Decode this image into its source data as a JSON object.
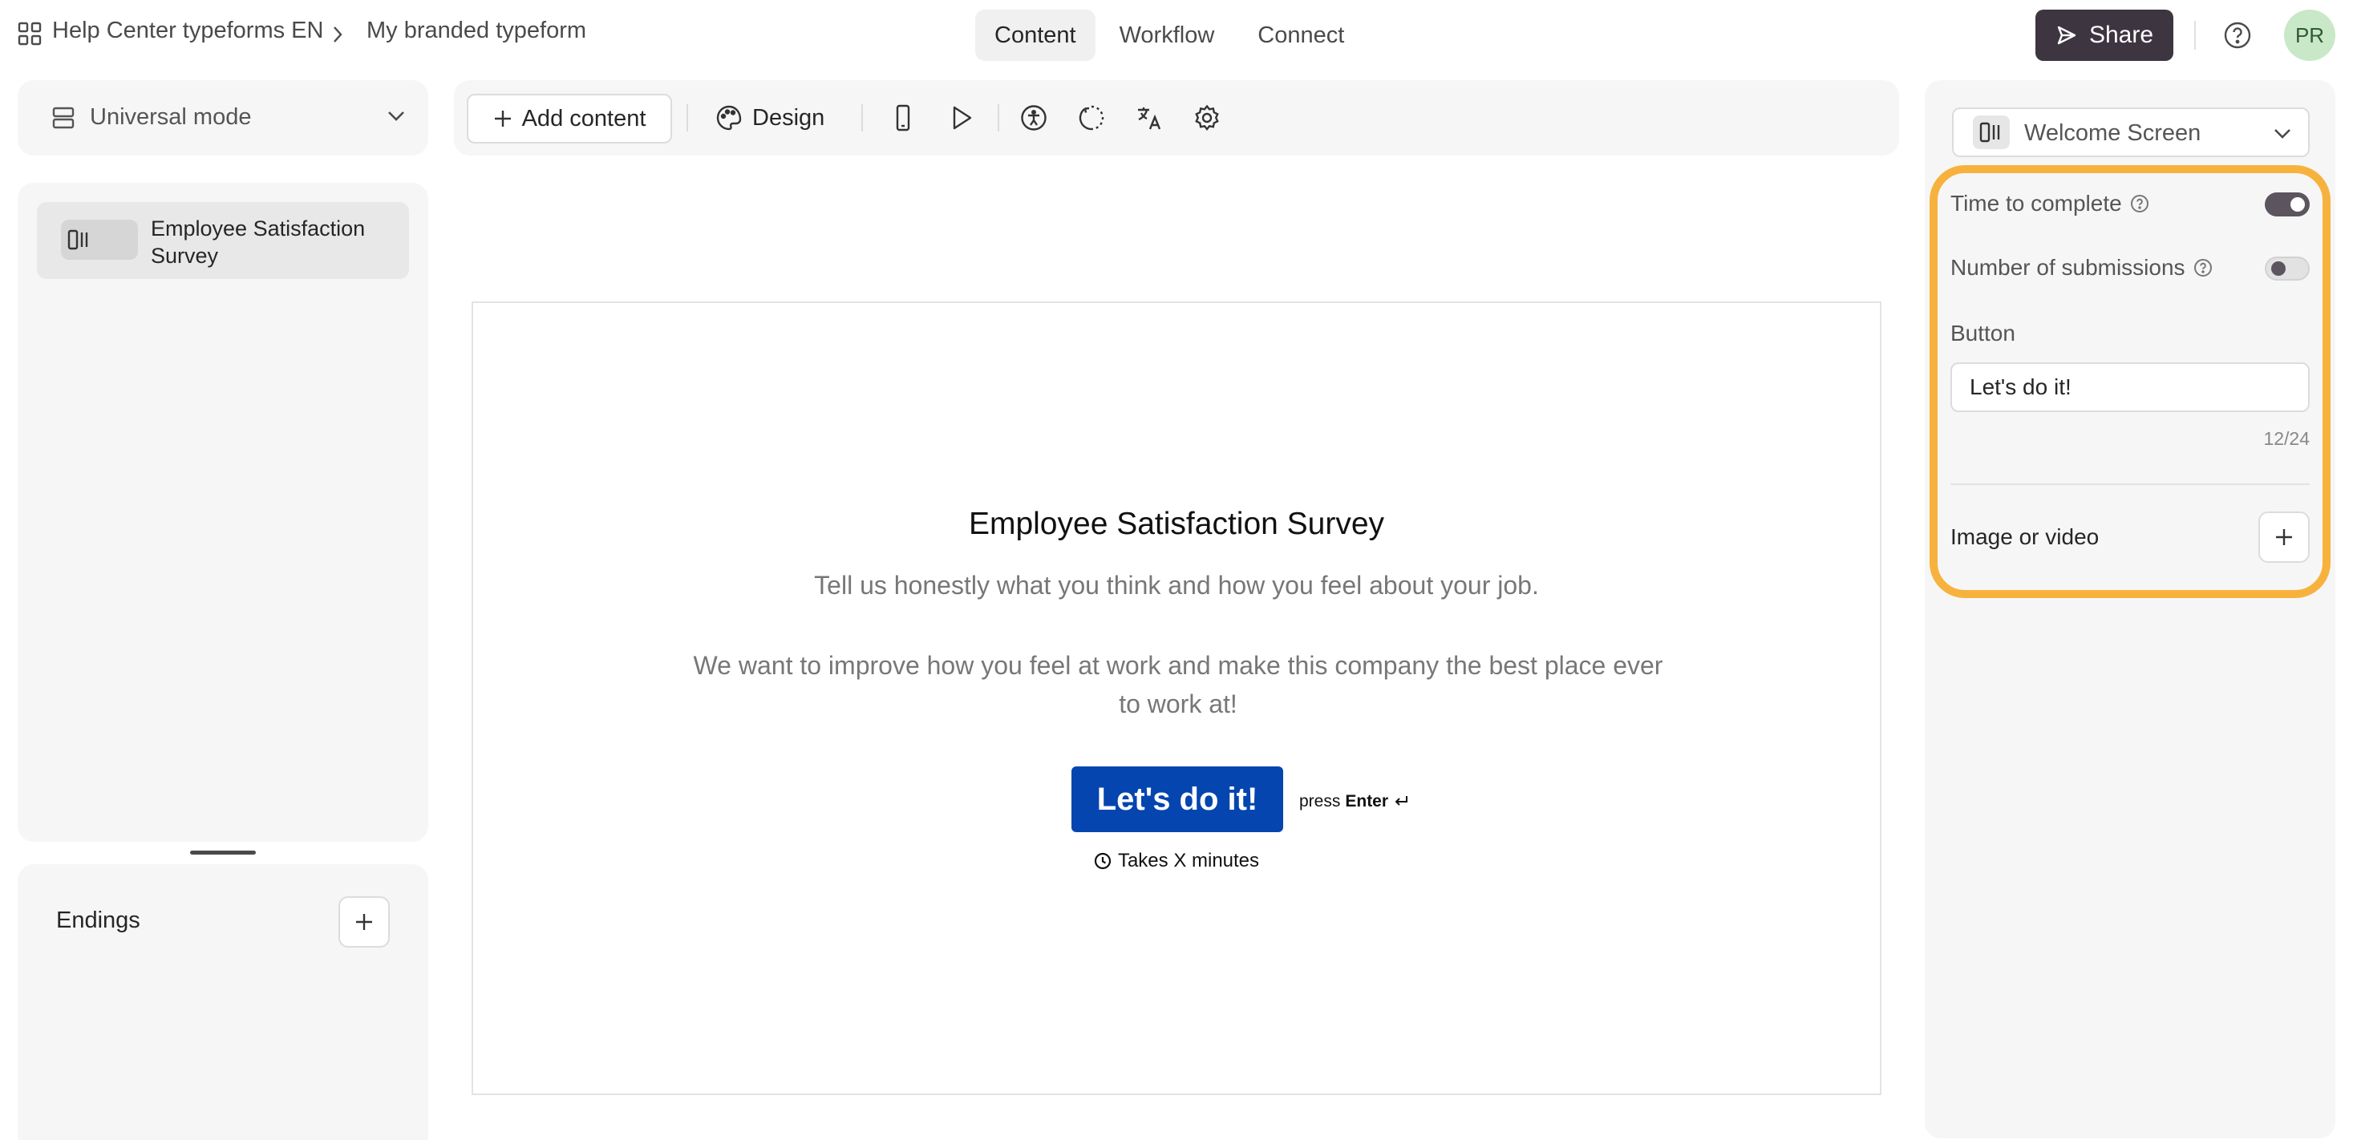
{
  "header": {
    "workspace": "Help Center typeforms EN",
    "form_name": "My branded typeform",
    "tabs": [
      {
        "label": "Content",
        "active": true
      },
      {
        "label": "Workflow",
        "active": false
      },
      {
        "label": "Connect",
        "active": false
      }
    ],
    "share_label": "Share",
    "avatar_initials": "PR"
  },
  "sidebar": {
    "mode_label": "Universal mode",
    "items": [
      {
        "label": "Employee Satisfaction Survey",
        "icon": "welcome-screen-icon"
      }
    ],
    "endings_label": "Endings"
  },
  "toolbar": {
    "add_content_label": "Add content",
    "design_label": "Design",
    "icons": [
      "mobile-preview-icon",
      "play-icon",
      "accessibility-icon",
      "loading-icon",
      "translate-icon",
      "settings-icon"
    ]
  },
  "canvas": {
    "title": "Employee Satisfaction Survey",
    "subtitle": "Tell us honestly what you think and how you feel about your job.",
    "description": "We want to improve how you feel at work and make this company the best place ever to work at!",
    "button_label": "Let's do it!",
    "press_text": "press",
    "press_key": "Enter",
    "takes_text": "Takes X minutes",
    "button_color": "#0445af"
  },
  "right_panel": {
    "screen_label": "Welcome Screen",
    "time_to_complete": {
      "label": "Time to complete",
      "enabled": true
    },
    "number_of_submissions": {
      "label": "Number of submissions",
      "enabled": false
    },
    "button_section_label": "Button",
    "button_value": "Let's do it!",
    "char_count": "12/24",
    "media_label": "Image or video",
    "highlight_color": "#f7b23e"
  },
  "colors": {
    "share_bg": "#3d3540",
    "avatar_bg": "#c9e8c8",
    "panel_bg": "#f6f6f6"
  }
}
